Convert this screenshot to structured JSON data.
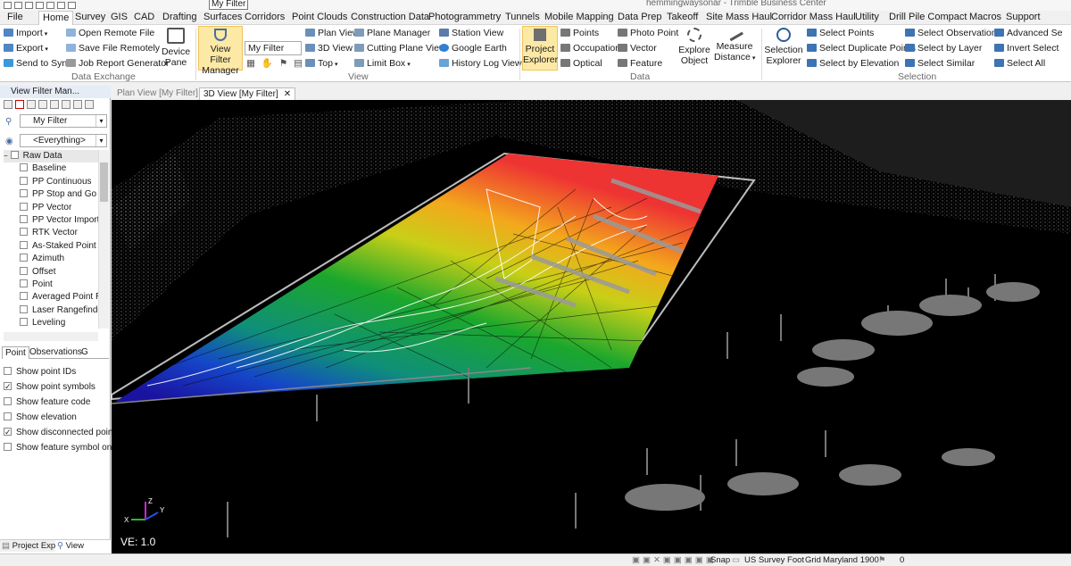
{
  "app": {
    "title": "hemmingwaysonar - Trimble Business Center",
    "filter_value": "My Filter"
  },
  "menu": [
    "File",
    "Home",
    "Survey",
    "GIS",
    "CAD",
    "Drafting",
    "Surfaces",
    "Corridors",
    "Point Clouds",
    "Construction Data",
    "Photogrammetry",
    "Tunnels",
    "Mobile Mapping",
    "Data Prep",
    "Takeoff",
    "Site Mass Haul",
    "Corridor Mass Haul",
    "Utility",
    "Drill Pile Compact",
    "Macros",
    "Support"
  ],
  "ribbon": {
    "data_exchange": {
      "label": "Data Exchange",
      "import": "Import",
      "export": "Export",
      "send_to_sync": "Send to Sync",
      "open_remote_file": "Open Remote File",
      "save_file_remotely": "Save File Remotely",
      "job_report_generator": "Job Report Generator",
      "device_pane": [
        "Device",
        "Pane"
      ]
    },
    "view": {
      "label": "View",
      "view_filter_manager": [
        "View Filter",
        "Manager"
      ],
      "filter_combo": "My Filter",
      "plan_view": "Plan View",
      "view_3d": "3D View",
      "top": "Top",
      "plane_manager": "Plane Manager",
      "cutting_plane_view": "Cutting Plane View",
      "limit_box": "Limit Box",
      "station_view": "Station View",
      "google_earth": "Google Earth",
      "history_log_view": "History Log View"
    },
    "data": {
      "label": "Data",
      "project_explorer": [
        "Project",
        "Explorer"
      ],
      "points": "Points",
      "occupation": "Occupation",
      "optical": "Optical",
      "photo_point": "Photo Point",
      "vector": "Vector",
      "feature": "Feature",
      "explore_object": [
        "Explore",
        "Object"
      ],
      "measure_distance": [
        "Measure",
        "Distance"
      ]
    },
    "selection": {
      "label": "Selection",
      "selection_explorer": [
        "Selection",
        "Explorer"
      ],
      "select_points": "Select Points",
      "select_duplicate_points": "Select Duplicate Points",
      "select_by_elevation": "Select by Elevation",
      "select_observations": "Select Observations",
      "select_by_layer": "Select by Layer",
      "select_similar": "Select Similar",
      "advanced_select": "Advanced Se",
      "invert_select": "Invert Select",
      "select_all": "Select All"
    }
  },
  "left_pane": {
    "title": "View Filter Man...",
    "filter": "My Filter",
    "scope": "<Everything>",
    "tree_root": "Raw Data",
    "tree_items": [
      "Baseline",
      "PP Continuous",
      "PP Stop and Go",
      "PP Vector",
      "PP Vector Import",
      "RTK Vector",
      "As-Staked Point",
      "Azimuth",
      "Offset",
      "Point",
      "Averaged Point R",
      "Laser Rangefinde",
      "Leveling"
    ],
    "tabs": [
      "Point",
      "Observations",
      "G"
    ],
    "options": [
      {
        "label": "Show point IDs",
        "checked": false
      },
      {
        "label": "Show point symbols",
        "checked": true
      },
      {
        "label": "Show feature code",
        "checked": false
      },
      {
        "label": "Show elevation",
        "checked": false
      },
      {
        "label": "Show disconnected points",
        "checked": true
      },
      {
        "label": "Show feature symbol only",
        "checked": false
      }
    ],
    "bottom_tabs": [
      "Project Exp...",
      "View Filter..."
    ]
  },
  "doc_tabs": [
    "Plan View [My Filter]",
    "3D View [My Filter]"
  ],
  "viewport": {
    "ve": "VE: 1.0",
    "axis": {
      "x": "X",
      "y": "Y",
      "z": "Z"
    }
  },
  "status": {
    "snap": "Snap",
    "units": "US Survey Foot",
    "grid": "Grid",
    "zone": "Maryland 1900",
    "count": "0"
  }
}
